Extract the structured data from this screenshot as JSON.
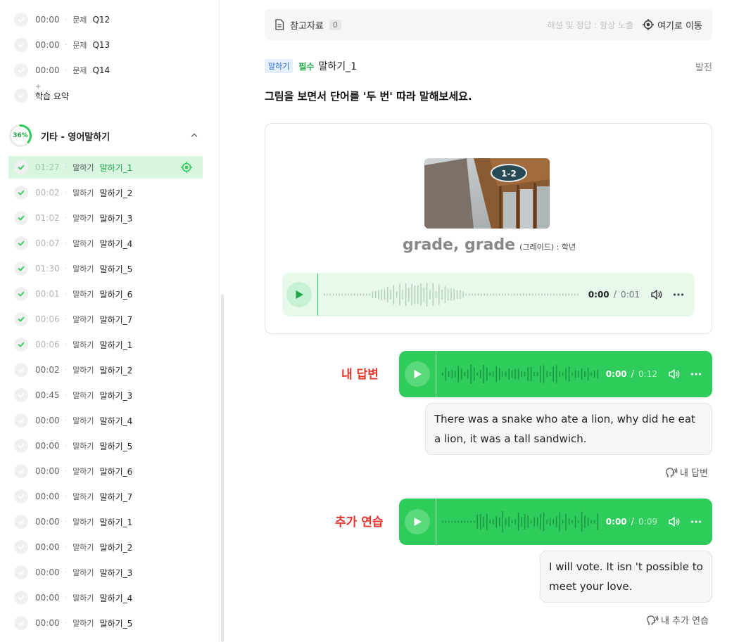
{
  "sidebar": {
    "top_items": [
      {
        "time": "00:00",
        "kind": "문제",
        "label": "Q12"
      },
      {
        "time": "00:00",
        "kind": "문제",
        "label": "Q13"
      },
      {
        "time": "00:00",
        "kind": "문제",
        "label": "Q14"
      }
    ],
    "summary_label": "학습 요약",
    "section": {
      "progress_text": "36%",
      "progress": 0.36,
      "title": "기타 - 영어말하기"
    },
    "items": [
      {
        "time": "01:27",
        "kind": "말하기",
        "label": "말하기_1",
        "done": true,
        "active": true
      },
      {
        "time": "00:02",
        "kind": "말하기",
        "label": "말하기_2",
        "done": true
      },
      {
        "time": "01:02",
        "kind": "말하기",
        "label": "말하기_3",
        "done": true
      },
      {
        "time": "00:07",
        "kind": "말하기",
        "label": "말하기_4",
        "done": true
      },
      {
        "time": "01:30",
        "kind": "말하기",
        "label": "말하기_5",
        "done": true
      },
      {
        "time": "00:01",
        "kind": "말하기",
        "label": "말하기_6",
        "done": true
      },
      {
        "time": "00:06",
        "kind": "말하기",
        "label": "말하기_7",
        "done": true
      },
      {
        "time": "00:06",
        "kind": "말하기",
        "label": "말하기_1",
        "done": true
      },
      {
        "time": "00:02",
        "kind": "말하기",
        "label": "말하기_2",
        "done": false
      },
      {
        "time": "00:45",
        "kind": "말하기",
        "label": "말하기_3",
        "done": false
      },
      {
        "time": "00:00",
        "kind": "말하기",
        "label": "말하기_4",
        "done": false
      },
      {
        "time": "00:00",
        "kind": "말하기",
        "label": "말하기_5",
        "done": false
      },
      {
        "time": "00:00",
        "kind": "말하기",
        "label": "말하기_6",
        "done": false
      },
      {
        "time": "00:00",
        "kind": "말하기",
        "label": "말하기_7",
        "done": false
      },
      {
        "time": "00:00",
        "kind": "말하기",
        "label": "말하기_1",
        "done": false
      },
      {
        "time": "00:00",
        "kind": "말하기",
        "label": "말하기_2",
        "done": false
      },
      {
        "time": "00:00",
        "kind": "말하기",
        "label": "말하기_3",
        "done": false
      },
      {
        "time": "00:00",
        "kind": "말하기",
        "label": "말하기_4",
        "done": false
      },
      {
        "time": "00:00",
        "kind": "말하기",
        "label": "말하기_5",
        "done": false
      }
    ]
  },
  "topbar": {
    "ref_label": "참고자료",
    "ref_count": "0",
    "hint": "해설 및 정답 : 항상 노출",
    "goto_label": "여기로 이동"
  },
  "question": {
    "tag": "말하기",
    "required": "필수",
    "name": "말하기_1",
    "level": "발전",
    "instruction": "그림을 보면서 단어를 '두 번' 따라 말해보세요."
  },
  "card": {
    "sign_text": "1-2",
    "word": "grade, grade",
    "meaning": "(그레이드) : 학년",
    "player": {
      "current": "0:00",
      "separator": "/",
      "total": "0:01"
    }
  },
  "answer": {
    "label": "내 답변",
    "player": {
      "current": "0:00",
      "separator": "/",
      "total": "0:12"
    },
    "text": "There was a snake who ate a lion, why did he eat a lion, it was a tall sandwich.",
    "caption": "내 답변"
  },
  "practice": {
    "label": "추가 연습",
    "player": {
      "current": "0:00",
      "separator": "/",
      "total": "0:09"
    },
    "text": "I will vote. It isn 't possible to meet your love.",
    "caption": "내 추가 연습"
  },
  "colors": {
    "accent_green": "#2ecc5b",
    "active_row": "#d8f6df",
    "label_red": "#e8352b",
    "tag_blue": "#2b6fd6"
  }
}
